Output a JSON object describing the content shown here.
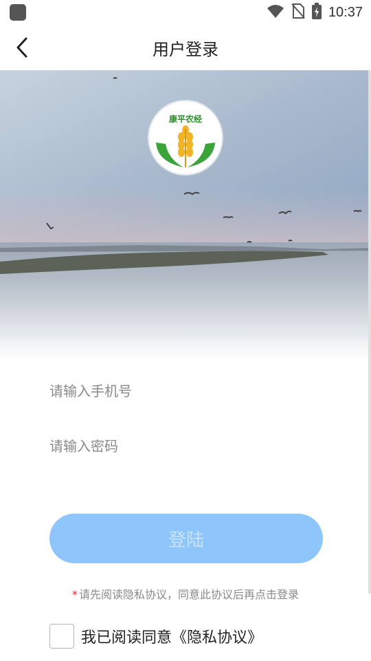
{
  "status_bar": {
    "time": "10:37",
    "icons": [
      "app-icon",
      "wifi-icon",
      "no-sim-icon",
      "battery-charging-icon"
    ]
  },
  "header": {
    "title": "用户登录",
    "back_icon": "chevron-left-icon"
  },
  "logo": {
    "text": "康平农经",
    "icon": "wheat-logo-icon",
    "colors": {
      "text": "#2e8b2e",
      "leaf": "#3aa33a",
      "wheat": "#f0b429"
    }
  },
  "form": {
    "phone_placeholder": "请输入手机号",
    "password_placeholder": "请输入密码",
    "login_label": "登陆"
  },
  "notice": {
    "star": "*",
    "text": "请先阅读隐私协议，同意此协议后再点击登录"
  },
  "agreement": {
    "label": "我已阅读同意《隐私协议》",
    "checked": false
  },
  "colors": {
    "button": "#8ec5fb",
    "button_text": "#c9e3fd",
    "placeholder": "#8a8a8a",
    "required_star": "#e23333"
  }
}
